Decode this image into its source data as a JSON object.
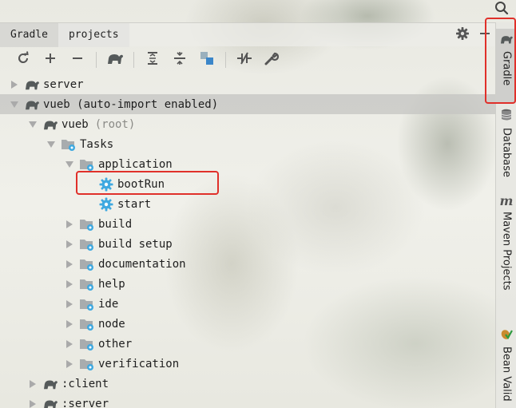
{
  "header": {
    "tabs": [
      {
        "label": "Gradle",
        "active": true
      },
      {
        "label": "projects",
        "active": false
      }
    ]
  },
  "toolbar": {
    "buttons": [
      {
        "name": "refresh-icon"
      },
      {
        "name": "plus-icon"
      },
      {
        "name": "minus-icon"
      },
      {
        "name": "gradle-elephant-icon"
      },
      {
        "name": "expand-all-icon"
      },
      {
        "name": "collapse-all-icon"
      },
      {
        "name": "group-modules-icon"
      },
      {
        "name": "toggle-offline-icon"
      },
      {
        "name": "wrench-icon"
      }
    ]
  },
  "tree": {
    "server": "server",
    "vueb": "vueb (auto-import enabled)",
    "vueb_root_name": "vueb",
    "vueb_root_suffix": "(root)",
    "tasks": "Tasks",
    "application": "application",
    "bootRun": "bootRun",
    "start": "start",
    "groups": [
      "build",
      "build setup",
      "documentation",
      "help",
      "ide",
      "node",
      "other",
      "verification"
    ],
    "client": ":client",
    "server_sub": ":server"
  },
  "right_bar": {
    "tabs": [
      "Gradle",
      "Database",
      "Maven Projects",
      "Bean Valid"
    ],
    "maven_icon_letter": "m"
  },
  "colors": {
    "highlight": "#e0302a",
    "gear_blue": "#3fa9e0",
    "elephant": "#555a5a"
  }
}
